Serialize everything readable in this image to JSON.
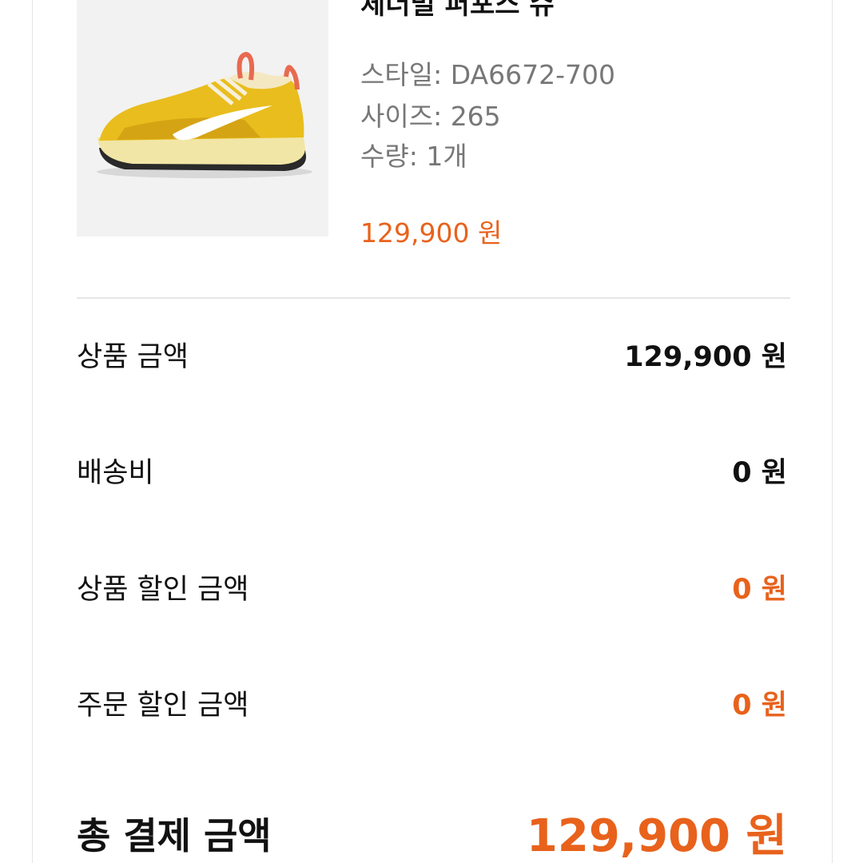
{
  "product": {
    "title": "체더빌 퍼포스 슈",
    "style": "스타일: DA6672-700",
    "size": "사이즈: 265",
    "quantity": "수량: 1개",
    "price": "129,900 원",
    "image_icon": "sneaker-image"
  },
  "summary": {
    "product_amount_label": "상품 금액",
    "product_amount_value": "129,900 원",
    "shipping_label": "배송비",
    "shipping_value": "0 원",
    "product_discount_label": "상품 할인 금액",
    "product_discount_value": "0 원",
    "order_discount_label": "주문 할인 금액",
    "order_discount_value": "0 원",
    "total_label": "총 결제 금액",
    "total_value": "129,900 원"
  },
  "colors": {
    "accent": "#e8621c",
    "text": "#111111",
    "muted": "#777777",
    "divider": "#e6e6e6"
  }
}
